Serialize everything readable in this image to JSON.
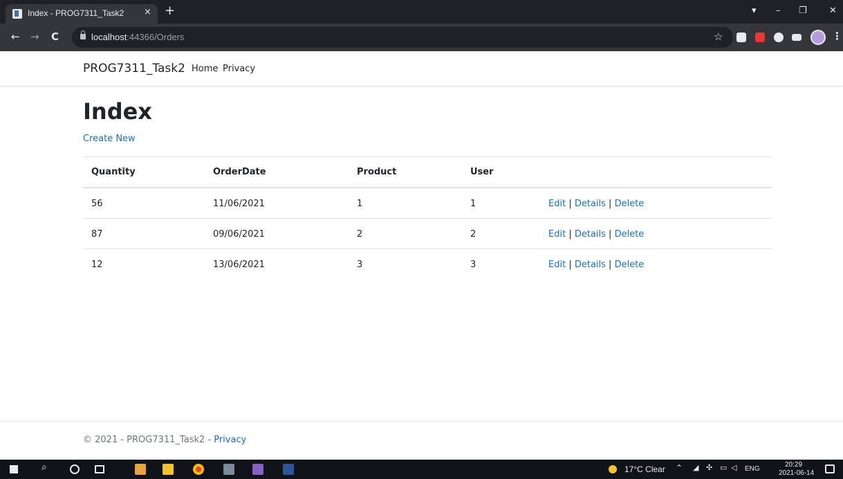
{
  "browser": {
    "tab_title": "Index - PROG7311_Task2",
    "tab_close": "×",
    "new_tab": "+",
    "url_host": "localhost",
    "url_rest": ":44366/Orders",
    "window_controls": {
      "dropdown": "▾",
      "minimize": "–",
      "restore": "❐",
      "close": "✕"
    },
    "nav": {
      "back": "←",
      "forward": "→",
      "reload": "C"
    },
    "star": "☆",
    "menu": "⋮"
  },
  "site": {
    "brand": "PROG7311_Task2",
    "nav_links": [
      "Home",
      "Privacy"
    ]
  },
  "main": {
    "title": "Index",
    "create_link": "Create New",
    "table": {
      "headers": [
        "Quantity",
        "OrderDate",
        "Product",
        "User"
      ],
      "rows": [
        {
          "quantity": "56",
          "order_date": "11/06/2021",
          "product": "1",
          "user": "1"
        },
        {
          "quantity": "87",
          "order_date": "09/06/2021",
          "product": "2",
          "user": "2"
        },
        {
          "quantity": "12",
          "order_date": "13/06/2021",
          "product": "3",
          "user": "3"
        }
      ],
      "actions": {
        "edit": "Edit",
        "details": "Details",
        "delete": "Delete",
        "separator": " | "
      }
    }
  },
  "footer": {
    "text": "© 2021 - PROG7311_Task2 - ",
    "link": "Privacy"
  },
  "taskbar": {
    "weather": "17°C  Clear",
    "lang": "ENG",
    "time": "20:29",
    "date": "2021-06-14"
  }
}
